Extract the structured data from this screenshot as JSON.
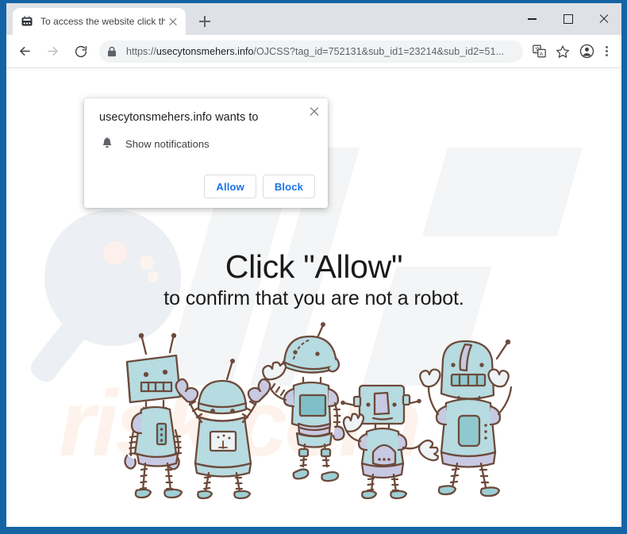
{
  "window": {
    "controls": {
      "minimize": "minimize-button",
      "maximize": "maximize-button",
      "close": "close-button"
    }
  },
  "tabstrip": {
    "tab": {
      "title": "To access the website click the \"A",
      "favicon": "robot-favicon",
      "close_label": "close-tab-icon"
    },
    "new_tab_label": "new-tab-icon"
  },
  "toolbar": {
    "back": "back-arrow-icon",
    "forward": "forward-arrow-icon",
    "reload": "reload-icon",
    "lock": "lock-icon",
    "url_scheme": "https://",
    "url_host": "usecytonsmehers.info",
    "url_path": "/OJCSS?tag_id=752131&sub_id1=23214&sub_id2=51...",
    "url_full": "https://usecytonsmehers.info/OJCSS?tag_id=752131&sub_id1=23214&sub_id2=51...",
    "translate": "translate-icon",
    "bookmark": "star-icon",
    "profile": "profile-avatar-icon",
    "menu": "three-dot-menu-icon"
  },
  "permission_dialog": {
    "title": "usecytonsmehers.info wants to",
    "permission_icon": "bell-icon",
    "permission_label": "Show notifications",
    "allow_label": "Allow",
    "block_label": "Block",
    "close_label": "close-dialog-icon",
    "accent_color": "#1a73e8"
  },
  "page": {
    "headline": "Click \"Allow\"",
    "subheadline": "to confirm that you are not a robot.",
    "watermark_text": "risk.com",
    "illustration": "five-cartoon-robots",
    "colors": {
      "robot_body": "#b6dbe0",
      "robot_outline": "#6d4a3b",
      "robot_accent": "#b9bedc",
      "robot_panel": "#8fc9cf",
      "page_background": "#ffffff",
      "watermark": "#fdf3ec"
    }
  }
}
